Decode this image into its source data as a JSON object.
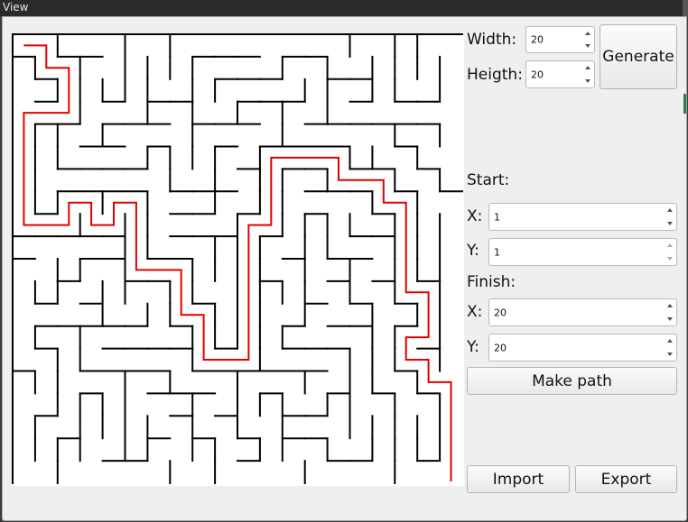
{
  "window": {
    "title": "View"
  },
  "controls": {
    "width_label": "Width:",
    "width_value": "20",
    "height_label": "Heigth:",
    "height_value": "20",
    "generate_label": "Generate",
    "start_label": "Start:",
    "start_x_label": "X:",
    "start_x_value": "1",
    "start_y_label": "Y:",
    "start_y_value": "1",
    "finish_label": "Finish:",
    "finish_x_label": "X:",
    "finish_x_value": "20",
    "finish_y_label": "Y:",
    "finish_y_value": "20",
    "make_path_label": "Make path",
    "import_label": "Import",
    "export_label": "Export"
  },
  "colors": {
    "wall": "#000000",
    "path": "#e00000",
    "background": "#efefef"
  },
  "maze": {
    "cols": 20,
    "rows": 20,
    "path_cells": [
      [
        1,
        1
      ],
      [
        2,
        1
      ],
      [
        2,
        2
      ],
      [
        3,
        2
      ],
      [
        3,
        3
      ],
      [
        3,
        4
      ],
      [
        2,
        4
      ],
      [
        1,
        4
      ],
      [
        1,
        5
      ],
      [
        1,
        6
      ],
      [
        1,
        7
      ],
      [
        1,
        8
      ],
      [
        1,
        9
      ],
      [
        2,
        9
      ],
      [
        3,
        9
      ],
      [
        3,
        8
      ],
      [
        4,
        8
      ],
      [
        4,
        9
      ],
      [
        5,
        9
      ],
      [
        5,
        8
      ],
      [
        6,
        8
      ],
      [
        6,
        9
      ],
      [
        6,
        10
      ],
      [
        6,
        11
      ],
      [
        7,
        11
      ],
      [
        8,
        11
      ],
      [
        8,
        12
      ],
      [
        8,
        13
      ],
      [
        9,
        13
      ],
      [
        9,
        14
      ],
      [
        9,
        15
      ],
      [
        10,
        15
      ],
      [
        11,
        15
      ],
      [
        11,
        14
      ],
      [
        11,
        13
      ],
      [
        11,
        12
      ],
      [
        11,
        11
      ],
      [
        11,
        10
      ],
      [
        11,
        9
      ],
      [
        12,
        9
      ],
      [
        12,
        8
      ],
      [
        12,
        7
      ],
      [
        12,
        6
      ],
      [
        13,
        6
      ],
      [
        14,
        6
      ],
      [
        15,
        6
      ],
      [
        15,
        7
      ],
      [
        16,
        7
      ],
      [
        17,
        7
      ],
      [
        17,
        8
      ],
      [
        18,
        8
      ],
      [
        18,
        9
      ],
      [
        18,
        10
      ],
      [
        18,
        11
      ],
      [
        18,
        12
      ],
      [
        19,
        12
      ],
      [
        19,
        13
      ],
      [
        19,
        14
      ],
      [
        18,
        14
      ],
      [
        18,
        15
      ],
      [
        19,
        15
      ],
      [
        19,
        16
      ],
      [
        20,
        16
      ],
      [
        20,
        17
      ],
      [
        20,
        18
      ],
      [
        20,
        19
      ],
      [
        20,
        20
      ]
    ]
  }
}
